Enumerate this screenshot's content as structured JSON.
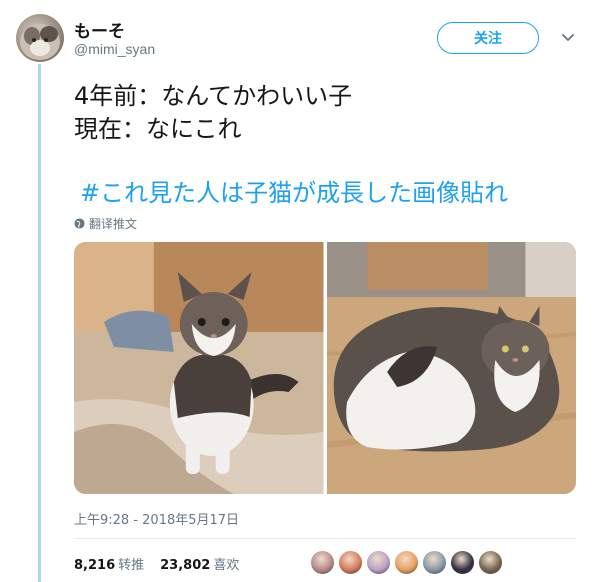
{
  "user": {
    "name": "もーそ",
    "handle": "@mimi_syan"
  },
  "follow_label": "关注",
  "tweet": {
    "line1": "4年前：なんてかわいい子",
    "line2": "現在：なにこれ",
    "hashtag": "#これ見た人は子猫が成長した画像貼れ"
  },
  "translate_label": "翻译推文",
  "timestamp": "上午9:28 - 2018年5月17日",
  "stats": {
    "retweets": "8,216",
    "retweets_label": "转推",
    "likes": "23,802",
    "likes_label": "喜欢"
  },
  "colors": {
    "accent": "#1da1f2",
    "thread_line": "#a8d8ea",
    "secondary_text": "#657786"
  },
  "liker_colors": [
    "#b88a8a",
    "#d47a5a",
    "#b8a0c8",
    "#e8a060",
    "#8899aa",
    "#333344",
    "#776655"
  ],
  "icons": {
    "chevron": "chevron-down-icon",
    "globe": "globe-icon"
  }
}
